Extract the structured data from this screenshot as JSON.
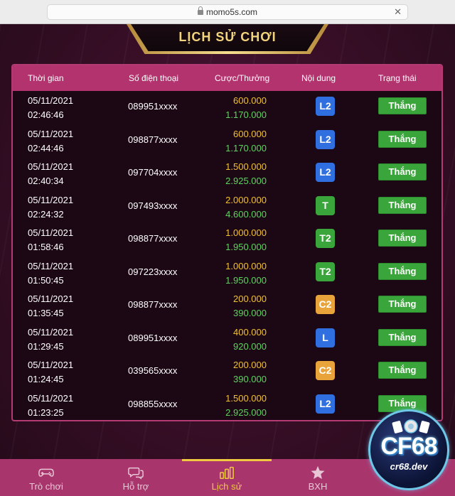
{
  "browser": {
    "url": "momo5s.com"
  },
  "title": "LỊCH SỬ CHƠI",
  "table": {
    "headers": {
      "time": "Thời gian",
      "phone": "Số điện thoại",
      "bet": "Cược/Thưởng",
      "content": "Nội dung",
      "status": "Trạng thái"
    },
    "rows": [
      {
        "date": "05/11/2021",
        "time": "02:46:46",
        "phone": "089951xxxx",
        "bet": "600.000",
        "reward": "1.170.000",
        "content": "L2",
        "content_color": "#2f6fe0",
        "status": "Thắng"
      },
      {
        "date": "05/11/2021",
        "time": "02:44:46",
        "phone": "098877xxxx",
        "bet": "600.000",
        "reward": "1.170.000",
        "content": "L2",
        "content_color": "#2f6fe0",
        "status": "Thắng"
      },
      {
        "date": "05/11/2021",
        "time": "02:40:34",
        "phone": "097704xxxx",
        "bet": "1.500.000",
        "reward": "2.925.000",
        "content": "L2",
        "content_color": "#2f6fe0",
        "status": "Thắng"
      },
      {
        "date": "05/11/2021",
        "time": "02:24:32",
        "phone": "097493xxxx",
        "bet": "2.000.000",
        "reward": "4.600.000",
        "content": "T",
        "content_color": "#3aa53a",
        "status": "Thắng"
      },
      {
        "date": "05/11/2021",
        "time": "01:58:46",
        "phone": "098877xxxx",
        "bet": "1.000.000",
        "reward": "1.950.000",
        "content": "T2",
        "content_color": "#3aa53a",
        "status": "Thắng"
      },
      {
        "date": "05/11/2021",
        "time": "01:50:45",
        "phone": "097223xxxx",
        "bet": "1.000.000",
        "reward": "1.950.000",
        "content": "T2",
        "content_color": "#3aa53a",
        "status": "Thắng"
      },
      {
        "date": "05/11/2021",
        "time": "01:35:45",
        "phone": "098877xxxx",
        "bet": "200.000",
        "reward": "390.000",
        "content": "C2",
        "content_color": "#e8a33a",
        "status": "Thắng"
      },
      {
        "date": "05/11/2021",
        "time": "01:29:45",
        "phone": "089951xxxx",
        "bet": "400.000",
        "reward": "920.000",
        "content": "L",
        "content_color": "#2f6fe0",
        "status": "Thắng"
      },
      {
        "date": "05/11/2021",
        "time": "01:24:45",
        "phone": "039565xxxx",
        "bet": "200.000",
        "reward": "390.000",
        "content": "C2",
        "content_color": "#e8a33a",
        "status": "Thắng"
      },
      {
        "date": "05/11/2021",
        "time": "01:23:25",
        "phone": "098855xxxx",
        "bet": "1.500.000",
        "reward": "2.925.000",
        "content": "L2",
        "content_color": "#2f6fe0",
        "status": "Thắng"
      }
    ]
  },
  "nav": {
    "items": [
      {
        "label": "Trò chơi",
        "icon": "gamepad-icon"
      },
      {
        "label": "Hỗ trợ",
        "icon": "chat-icon"
      },
      {
        "label": "Lịch sử",
        "icon": "history-bars-icon",
        "active": true
      },
      {
        "label": "BXH",
        "icon": "star-icon"
      }
    ]
  },
  "logo": {
    "text": "CF68",
    "sub": "cr68.dev"
  },
  "colors": {
    "accent": "#f0c940",
    "panel_border": "#b33a72",
    "win": "#3aa53a"
  }
}
